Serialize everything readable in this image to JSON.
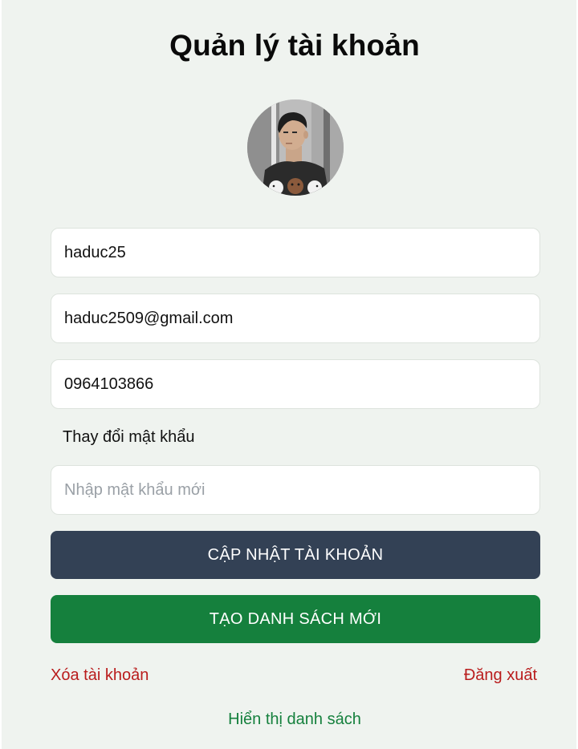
{
  "page": {
    "title": "Quản lý tài khoản"
  },
  "profile": {
    "username": "haduc25",
    "email": "haduc2509@gmail.com",
    "phone": "0964103866"
  },
  "password": {
    "section_label": "Thay đổi mật khẩu",
    "placeholder": "Nhập mật khẩu mới",
    "value": ""
  },
  "actions": {
    "update_label": "CẬP NHẬT TÀI KHOẢN",
    "create_list_label": "TẠO DANH SÁCH MỚI",
    "delete_label": "Xóa tài khoản",
    "logout_label": "Đăng xuất",
    "show_list_label": "Hiển thị danh sách"
  },
  "colors": {
    "background": "#eff3ef",
    "update_button": "#334155",
    "create_button": "#15803d",
    "danger_link": "#b91c1c",
    "success_link": "#15803d"
  }
}
